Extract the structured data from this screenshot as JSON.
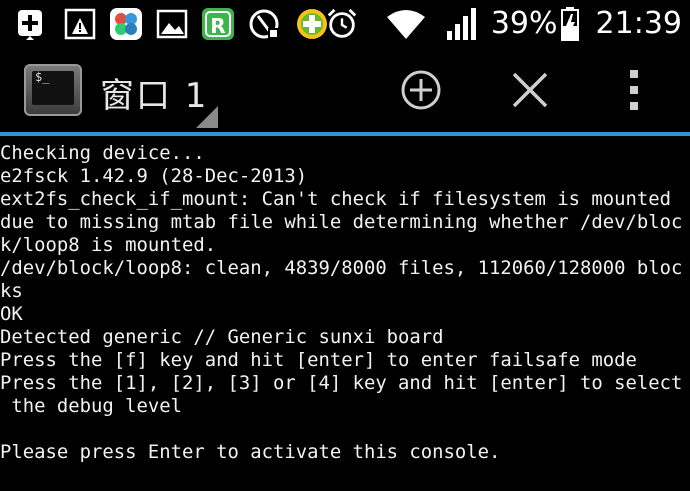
{
  "status_bar": {
    "left_icons": [
      "add-box-icon",
      "warning-image-icon",
      "pinwheel-app-icon",
      "image-icon",
      "r-app-icon",
      "clean-app-icon",
      "plus-ball-app-icon"
    ],
    "right_icons": [
      "alarm-icon",
      "wifi-icon",
      "signal-icon"
    ],
    "battery_percent": "39%",
    "battery_charging": true,
    "time": "21:39"
  },
  "action_bar": {
    "title": "窗口 1",
    "app_icon": "terminal-icon",
    "prompt_glyph": "$_",
    "actions": [
      "add-window",
      "close-window",
      "overflow-menu"
    ],
    "accent_color": "#2f95d6"
  },
  "terminal": {
    "lines": [
      "Checking device...",
      "e2fsck 1.42.9 (28-Dec-2013)",
      "ext2fs_check_if_mount: Can't check if filesystem is mounted",
      "due to missing mtab file while determining whether /dev/bloc",
      "k/loop8 is mounted.",
      "/dev/block/loop8: clean, 4839/8000 files, 112060/128000 bloc",
      "ks",
      "OK",
      "Detected generic // Generic sunxi board",
      "Press the [f] key and hit [enter] to enter failsafe mode",
      "Press the [1], [2], [3] or [4] key and hit [enter] to select",
      " the debug level",
      "",
      "Please press Enter to activate this console."
    ]
  }
}
